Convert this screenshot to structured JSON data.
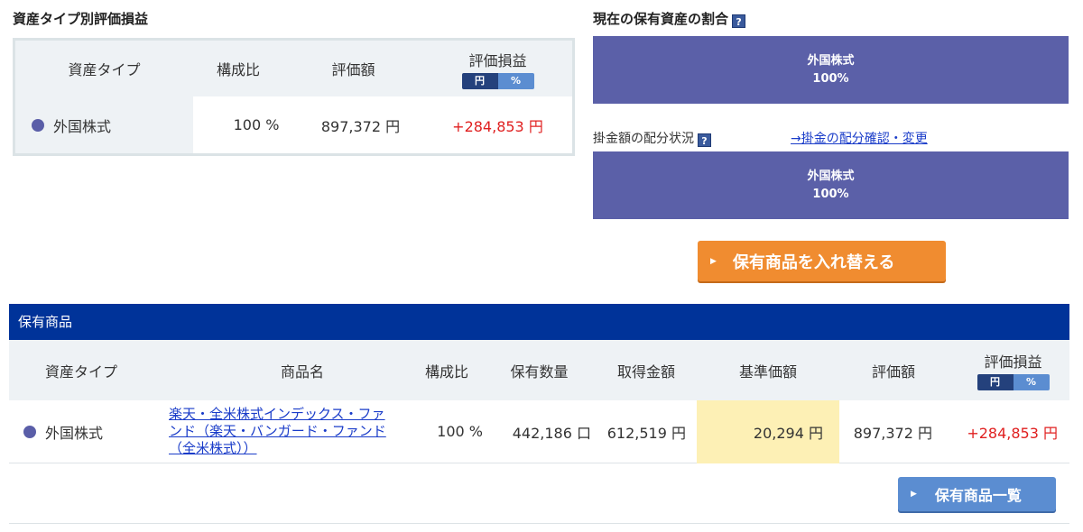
{
  "summary": {
    "title": "資産タイプ別評価損益",
    "headers": {
      "asset_type": "資産タイプ",
      "ratio": "構成比",
      "value": "評価額",
      "gain": "評価損益"
    },
    "toggle": {
      "yen": "円",
      "pct": "%"
    },
    "row": {
      "asset_type": "外国株式",
      "ratio": "100 %",
      "value": "897,372 円",
      "gain": "+284,853 円"
    }
  },
  "allocation": {
    "current_title": "現在の保有資産の割合",
    "current_bar": {
      "label": "外国株式",
      "pct": "100%"
    },
    "contribution_title": "掛金額の配分状況",
    "contribution_link": "→掛金の配分確認・変更",
    "contribution_bar": {
      "label": "外国株式",
      "pct": "100%"
    },
    "switch_button": "保有商品を入れ替える",
    "help_glyph": "?"
  },
  "holdings": {
    "title": "保有商品",
    "headers": {
      "asset_type": "資産タイプ",
      "product": "商品名",
      "ratio": "構成比",
      "quantity": "保有数量",
      "cost": "取得金額",
      "nav": "基準価額",
      "value": "評価額",
      "gain": "評価損益"
    },
    "toggle": {
      "yen": "円",
      "pct": "%"
    },
    "rows": [
      {
        "asset_type": "外国株式",
        "product": "楽天・全米株式インデックス・ファンド（楽天・バンガード・ファンド（全米株式））",
        "ratio": "100 %",
        "quantity": "442,186 口",
        "cost": "612,519 円",
        "nav": "20,294 円",
        "value": "897,372 円",
        "gain": "+284,853 円"
      }
    ],
    "list_button": "保有商品一覧"
  },
  "colors": {
    "navy": "#003399",
    "bar": "#5b60a8",
    "orange": "#f08c30",
    "gain_red": "#e02020",
    "highlight": "#fdf0b5"
  }
}
